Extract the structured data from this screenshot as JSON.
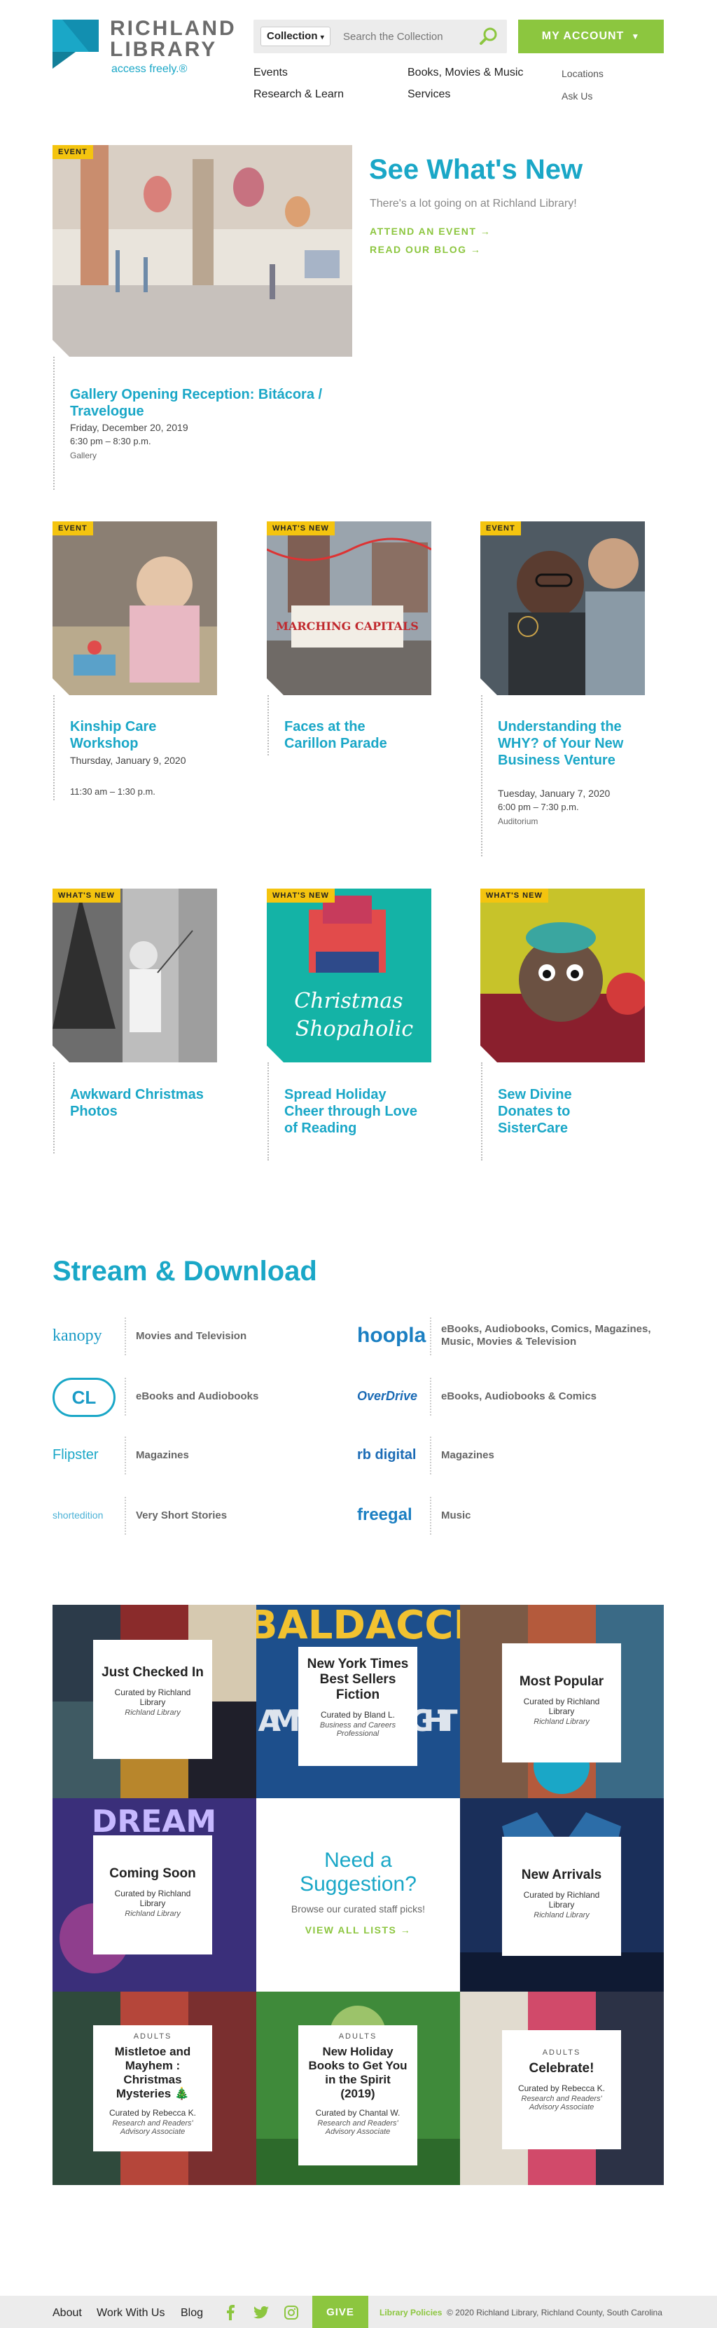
{
  "header": {
    "logo_title_line1": "RICHLAND",
    "logo_title_line2": "LIBRARY",
    "logo_tagline": "access freely.®",
    "search": {
      "scope_selected": "Collection",
      "placeholder": "Search the Collection"
    },
    "account_label": "MY ACCOUNT"
  },
  "nav": {
    "primary": [
      "Events",
      "Books, Movies & Music",
      "Research & Learn",
      "Services"
    ],
    "secondary": [
      "Locations",
      "Ask Us"
    ]
  },
  "hero": {
    "badge": "EVENT",
    "title": "Gallery Opening Reception: Bitácora / Travelogue",
    "date": "Friday, December 20, 2019",
    "time": "6:30 pm – 8:30 p.m.",
    "location": "Gallery",
    "heading": "See What's New",
    "subheading": "There's a lot going on at Richland Library!",
    "link1": "ATTEND AN EVENT →",
    "link2": "READ OUR BLOG →"
  },
  "cards_row1": [
    {
      "badge": "EVENT",
      "title": "Kinship Care Workshop",
      "date": "Thursday, January 9, 2020",
      "time": "11:30 am – 1:30 p.m.",
      "location": ""
    },
    {
      "badge": "WHAT'S NEW",
      "title": "Faces at the Carillon Parade",
      "date": "",
      "time": "",
      "location": ""
    },
    {
      "badge": "EVENT",
      "title": "Understanding the WHY? of Your New Business Venture",
      "date": "Tuesday, January 7, 2020",
      "time": "6:00 pm – 7:30 p.m.",
      "location": "Auditorium"
    }
  ],
  "cards_row2": [
    {
      "badge": "WHAT'S NEW",
      "title": "Awkward Christmas Photos"
    },
    {
      "badge": "WHAT'S NEW",
      "title": "Spread Holiday Cheer through Love of Reading",
      "image_text": "Christmas Shopaholic"
    },
    {
      "badge": "WHAT'S NEW",
      "title": "Sew Divine Donates to SisterCare"
    }
  ],
  "stream": {
    "heading": "Stream & Download",
    "items": [
      {
        "logo": "kanopy",
        "text": "Movies and Television"
      },
      {
        "logo": "hoopla",
        "text": "eBooks, Audiobooks, Comics, Magazines, Music, Movies & Television"
      },
      {
        "logo": "CL",
        "text": "eBooks and Audiobooks"
      },
      {
        "logo": "OverDrive",
        "text": "eBooks, Audiobooks & Comics"
      },
      {
        "logo": "Flipster",
        "text": "Magazines"
      },
      {
        "logo": "rb digital",
        "text": "Magazines"
      },
      {
        "logo": "shortedition",
        "text": "Very Short Stories"
      },
      {
        "logo": "freegal",
        "text": "Music"
      }
    ]
  },
  "lists": {
    "just_checked_in": {
      "title": "Just Checked In",
      "curator": "Curated by Richland Library",
      "role": "Richland Library"
    },
    "nyt": {
      "title": "New York Times Best Sellers Fiction",
      "curator": "Curated by Bland L.",
      "role": "Business and Careers Professional",
      "bg_text1": "BALDACCI",
      "bg_text2": "A MINUTE TO MIDNIGHT"
    },
    "most_popular": {
      "title": "Most Popular",
      "curator": "Curated by Richland Library",
      "role": "Richland Library"
    },
    "coming_soon": {
      "title": "Coming Soon",
      "curator": "Curated by Richland Library",
      "role": "Richland Library",
      "bg_text": "DREAM"
    },
    "suggestion": {
      "heading": "Need a Suggestion?",
      "sub": "Browse our curated staff picks!",
      "link": "VIEW ALL LISTS →"
    },
    "new_arrivals": {
      "title": "New Arrivals",
      "curator": "Curated by Richland Library",
      "role": "Richland Library"
    },
    "mistletoe": {
      "kicker": "ADULTS",
      "title": "Mistletoe and Mayhem : Christmas Mysteries 🎄",
      "curator": "Curated by Rebecca K.",
      "role": "Research and Readers' Advisory Associate"
    },
    "holiday": {
      "kicker": "ADULTS",
      "title": "New Holiday Books to Get You in the Spirit (2019)",
      "curator": "Curated by Chantal W.",
      "role": "Research and Readers' Advisory Associate"
    },
    "celebrate": {
      "kicker": "ADULTS",
      "title": "Celebrate!",
      "curator": "Curated by Rebecca K.",
      "role": "Research and Readers' Advisory Associate"
    }
  },
  "footer": {
    "links": [
      "About",
      "Work With Us",
      "Blog"
    ],
    "give": "GIVE",
    "policies": "Library Policies",
    "copyright": "© 2020 Richland Library, Richland County, South Carolina"
  },
  "colors": {
    "brand_blue": "#1aa7c7",
    "brand_green": "#8cc63f",
    "badge_yellow": "#f4c40f"
  }
}
